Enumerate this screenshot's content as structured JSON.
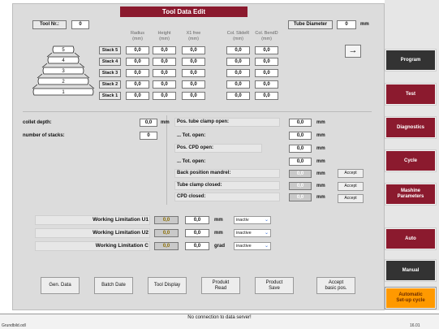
{
  "title": "Tool Data Edit",
  "tool_nr": {
    "label": "Tool Nr.:",
    "value": "0"
  },
  "tube_diameter": {
    "label": "Tube Diameter",
    "value": "0",
    "unit": "mm"
  },
  "columns": [
    {
      "line1": "Radius",
      "line2": "(mm)"
    },
    {
      "line1": "Height",
      "line2": "(mm)"
    },
    {
      "line1": "X1 free",
      "line2": "(mm)"
    },
    {
      "line1": "Col. SlideR",
      "line2": "(mm)"
    },
    {
      "line1": "Col. BendD",
      "line2": "(mm)"
    }
  ],
  "stacks": [
    {
      "label": "Stack 5",
      "num": "5",
      "values": [
        "0,0",
        "0,0",
        "0,0",
        "0,0",
        "0,0"
      ]
    },
    {
      "label": "Stack 4",
      "num": "4",
      "values": [
        "0,0",
        "0,0",
        "0,0",
        "0,0",
        "0,0"
      ]
    },
    {
      "label": "Stack 3",
      "num": "3",
      "values": [
        "0,0",
        "0,0",
        "0,0",
        "0,0",
        "0,0"
      ]
    },
    {
      "label": "Stack 2",
      "num": "2",
      "values": [
        "0,0",
        "0,0",
        "0,0",
        "0,0",
        "0,0"
      ]
    },
    {
      "label": "Stack 1",
      "num": "1",
      "values": [
        "0,0",
        "0,0",
        "0,0",
        "0,0",
        "0,0"
      ]
    }
  ],
  "arrow_button": "→",
  "collet_depth": {
    "label": "collet depth:",
    "value": "0,0",
    "unit": "mm"
  },
  "number_of_stacks": {
    "label": "number of stacks:",
    "value": "0"
  },
  "right_params": [
    {
      "label": "Pos. tube clamp open:",
      "value": "0,0",
      "unit": "mm",
      "grey": false
    },
    {
      "label": "... Tot. open:",
      "value": "0,0",
      "unit": "mm",
      "grey": false
    },
    {
      "label": "Pos. CPD open:",
      "value": "0,0",
      "unit": "mm",
      "grey": false
    },
    {
      "label": "... Tot. open:",
      "value": "0,0",
      "unit": "mm",
      "grey": false
    },
    {
      "label": "Back position mandrel:",
      "value": "0,0",
      "unit": "mm",
      "grey": true,
      "accept": "Accept"
    },
    {
      "label": "Tube clamp closed:",
      "value": "0,0",
      "unit": "mm",
      "grey": true,
      "accept": "Accept"
    },
    {
      "label": "CPD closed:",
      "value": "0,0",
      "unit": "mm",
      "grey": true,
      "accept": "Accept"
    }
  ],
  "limitations": [
    {
      "label": "Working Limitation U1",
      "current": "0,0",
      "value": "0,0",
      "unit": "mm",
      "state": "inactiv"
    },
    {
      "label": "Working Limitation U2",
      "current": "0,0",
      "value": "0,0",
      "unit": "mm",
      "state": "inactive"
    },
    {
      "label": "Working Limitation C",
      "current": "0,0",
      "value": "0,0",
      "unit": "grad",
      "state": "inactive"
    }
  ],
  "bottom_buttons": [
    {
      "line1": "Gen. Data",
      "line2": ""
    },
    {
      "line1": "Batch Date",
      "line2": ""
    },
    {
      "line1": "Tool Display",
      "line2": ""
    },
    {
      "line1": "Produkt",
      "line2": "Read"
    },
    {
      "line1": "Product",
      "line2": "Save"
    },
    {
      "line1": "Accept",
      "line2": "basic pos."
    }
  ],
  "sidebar": [
    {
      "line1": "Program",
      "line2": "",
      "style": "dark"
    },
    {
      "line1": "Test",
      "line2": "",
      "style": "red"
    },
    {
      "line1": "Diagnostics",
      "line2": "",
      "style": "red"
    },
    {
      "line1": "Cycle",
      "line2": "",
      "style": "red"
    },
    {
      "line1": "Mashine",
      "line2": "Parameters",
      "style": "red"
    },
    {
      "line1": "Auto",
      "line2": "",
      "style": "red"
    },
    {
      "line1": "Manual",
      "line2": "",
      "style": "dark"
    },
    {
      "line1": "Automatic",
      "line2": "Set-up cycle",
      "style": "orange"
    }
  ],
  "status": {
    "message": "No connection to data server!",
    "left": "Grundbild.odl",
    "right": "16.01"
  },
  "colors": {
    "accent": "#8b1a2e",
    "dark": "#333333",
    "orange": "#ff9900",
    "panel": "#dcdcdc"
  }
}
